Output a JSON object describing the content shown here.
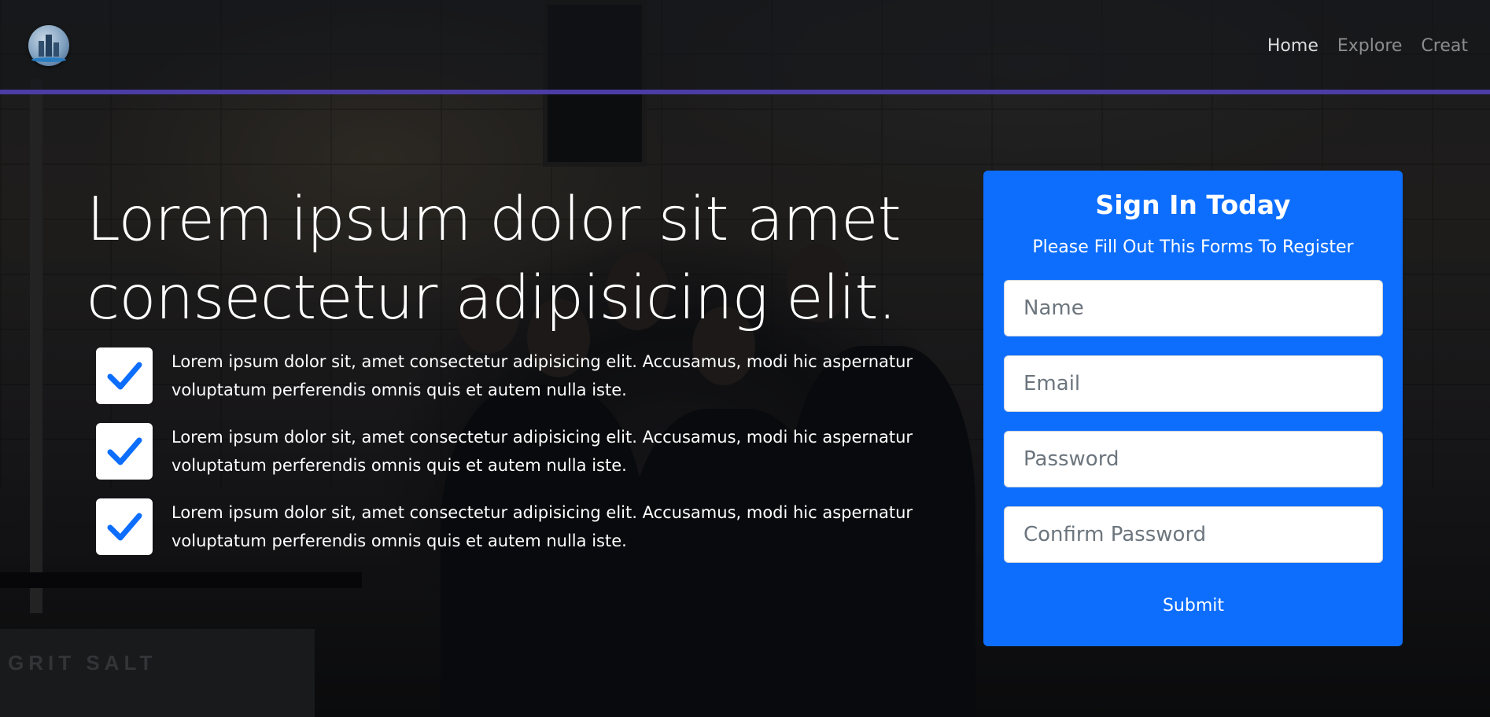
{
  "navbar": {
    "logo": "building-logo-icon",
    "links": [
      {
        "label": "Home",
        "active": true
      },
      {
        "label": "Explore",
        "active": false
      },
      {
        "label": "Creat",
        "active": false
      }
    ],
    "accent_color": "#4b3ca6"
  },
  "hero": {
    "headline_line1": "Lorem ipsum dolor sit amet",
    "headline_line2": "consectetur adipisicing elit.",
    "features": [
      {
        "icon": "checkmark-icon",
        "line1": "Lorem ipsum dolor sit, amet consectetur adipisicing elit. Accusamus, modi hic aspernatur",
        "line2": "voluptatum perferendis omnis quis et autem nulla iste."
      },
      {
        "icon": "checkmark-icon",
        "line1": "Lorem ipsum dolor sit, amet consectetur adipisicing elit. Accusamus, modi hic aspernatur",
        "line2": "voluptatum perferendis omnis quis et autem nulla iste."
      },
      {
        "icon": "checkmark-icon",
        "line1": "Lorem ipsum dolor sit, amet consectetur adipisicing elit. Accusamus, modi hic aspernatur",
        "line2": "voluptatum perferendis omnis quis et autem nulla iste."
      }
    ]
  },
  "background": {
    "sign_text": "GRIT SALT"
  },
  "signin": {
    "title": "Sign In Today",
    "subtitle": "Please Fill Out This Forms To Register",
    "fields": [
      {
        "placeholder": "Name",
        "value": ""
      },
      {
        "placeholder": "Email",
        "value": ""
      },
      {
        "placeholder": "Password",
        "value": ""
      },
      {
        "placeholder": "Confirm Password",
        "value": ""
      }
    ],
    "submit_label": "Submit",
    "card_color": "#0d6efd"
  }
}
